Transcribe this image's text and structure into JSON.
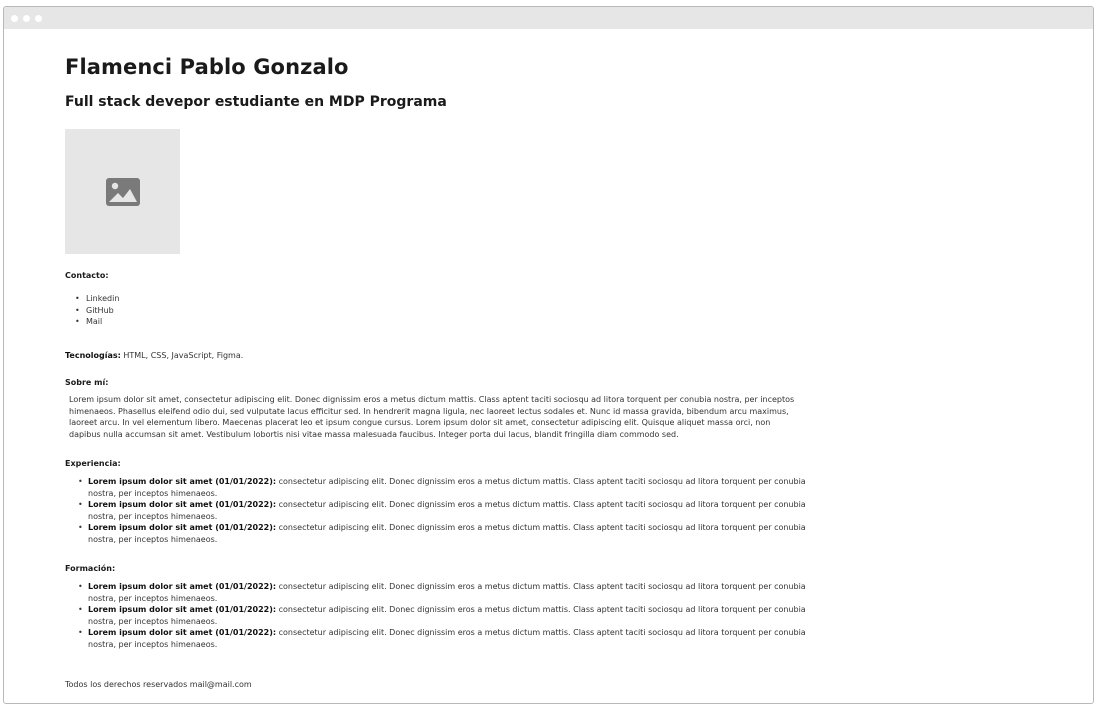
{
  "header": {
    "name": "Flamenci Pablo Gonzalo",
    "subtitle": "Full stack devepor estudiante en MDP Programa"
  },
  "photo": {
    "icon": "image-placeholder-icon",
    "color": "#7a7a7a"
  },
  "contact": {
    "label": "Contacto:",
    "items": [
      "Linkedin",
      "GitHub",
      "Mail"
    ]
  },
  "tech": {
    "label": "Tecnologías:",
    "value": " HTML, CSS, JavaScript, Figma."
  },
  "about": {
    "label": "Sobre mí:",
    "text": "Lorem ipsum dolor sit amet, consectetur adipiscing elit. Donec dignissim eros a metus dictum mattis. Class aptent taciti sociosqu ad litora torquent per conubia nostra, per inceptos himenaeos. Phasellus eleifend odio dui, sed vulputate lacus efficitur sed. In hendrerit magna ligula, nec laoreet lectus sodales et. Nunc id massa gravida, bibendum arcu maximus, laoreet arcu. In vel elementum libero. Maecenas placerat leo et ipsum congue cursus. Lorem ipsum dolor sit amet, consectetur adipiscing elit. Quisque aliquet massa orci, non dapibus nulla accumsan sit amet. Vestibulum lobortis nisi vitae massa malesuada faucibus. Integer porta dui lacus, blandit fringilla diam commodo sed."
  },
  "experience": {
    "label": "Experiencia:",
    "items": [
      {
        "title": "Lorem ipsum dolor sit amet (01/01/2022):",
        "text": " consectetur adipiscing elit. Donec dignissim eros a metus dictum mattis. Class aptent taciti sociosqu ad litora torquent per conubia nostra, per inceptos himenaeos."
      },
      {
        "title": "Lorem ipsum dolor sit amet (01/01/2022):",
        "text": " consectetur adipiscing elit. Donec dignissim eros a metus dictum mattis. Class aptent taciti sociosqu ad litora torquent per conubia nostra, per inceptos himenaeos."
      },
      {
        "title": "Lorem ipsum dolor sit amet (01/01/2022):",
        "text": " consectetur adipiscing elit. Donec dignissim eros a metus dictum mattis. Class aptent taciti sociosqu ad litora torquent per conubia nostra, per inceptos himenaeos."
      }
    ]
  },
  "education": {
    "label": "Formación:",
    "items": [
      {
        "title": "Lorem ipsum dolor sit amet (01/01/2022):",
        "text": " consectetur adipiscing elit. Donec dignissim eros a metus dictum mattis. Class aptent taciti sociosqu ad litora torquent per conubia nostra, per inceptos himenaeos."
      },
      {
        "title": "Lorem ipsum dolor sit amet (01/01/2022):",
        "text": " consectetur adipiscing elit. Donec dignissim eros a metus dictum mattis. Class aptent taciti sociosqu ad litora torquent per conubia nostra, per inceptos himenaeos."
      },
      {
        "title": "Lorem ipsum dolor sit amet (01/01/2022):",
        "text": " consectetur adipiscing elit. Donec dignissim eros a metus dictum mattis. Class aptent taciti sociosqu ad litora torquent per conubia nostra, per inceptos himenaeos."
      }
    ]
  },
  "footer": {
    "text": "Todos los derechos reservados mail@mail.com"
  }
}
